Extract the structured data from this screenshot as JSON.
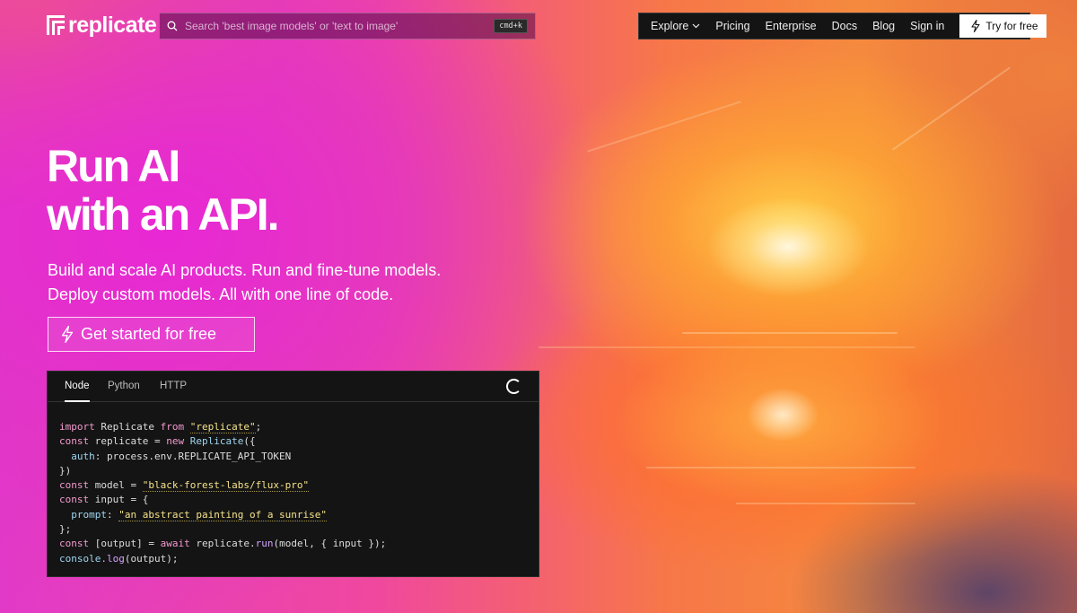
{
  "brand": {
    "name": "replicate"
  },
  "search": {
    "placeholder": "Search 'best image models' or 'text to image'",
    "shortcut": "cmd+k"
  },
  "nav": {
    "explore": "Explore",
    "pricing": "Pricing",
    "enterprise": "Enterprise",
    "docs": "Docs",
    "blog": "Blog",
    "sign_in": "Sign in",
    "try_free": "Try for free"
  },
  "hero": {
    "title_line1": "Run AI",
    "title_line2": "with an API.",
    "subtitle_line1": "Build and scale AI products. Run and fine-tune models.",
    "subtitle_line2": "Deploy custom models. All with one line of code.",
    "cta": "Get started for free"
  },
  "code": {
    "tabs": [
      "Node",
      "Python",
      "HTTP"
    ],
    "active_tab": "Node",
    "lines": {
      "import_kw": "import",
      "import_name": " Replicate ",
      "from_kw": "from",
      "import_src": "\"replicate\"",
      "import_end": ";",
      "const1": "const",
      "replicate_var": " replicate = ",
      "new_kw": "new",
      "ctor": " Replicate",
      "ctor_open": "({",
      "auth_key": "auth",
      "auth_val": ": process.env.REPLICATE_API_TOKEN",
      "close1": "})",
      "const2": "const",
      "model_var": " model = ",
      "model_val": "\"black-forest-labs/flux-pro\"",
      "const3": "const",
      "input_var": " input = {",
      "prompt_key": "prompt",
      "prompt_sep": ": ",
      "prompt_val": "\"an abstract painting of a sunrise\"",
      "close2": "};",
      "const4": "const",
      "output_destructure": " [output] = ",
      "await_kw": "await",
      "run_pre": " replicate.",
      "run_fn": "run",
      "run_args": "(model, { input });",
      "console_obj": "console",
      "log_fn": ".log",
      "log_args": "(output);"
    }
  },
  "icons": {
    "search": "search-icon",
    "chevron": "chevron-down-icon",
    "lightning": "lightning-icon",
    "spinner": "loading-spinner-icon"
  },
  "colors": {
    "nav_bg": "#141414",
    "code_bg": "#141414",
    "keyword": "#f59ad0",
    "string": "#f5e38a"
  }
}
